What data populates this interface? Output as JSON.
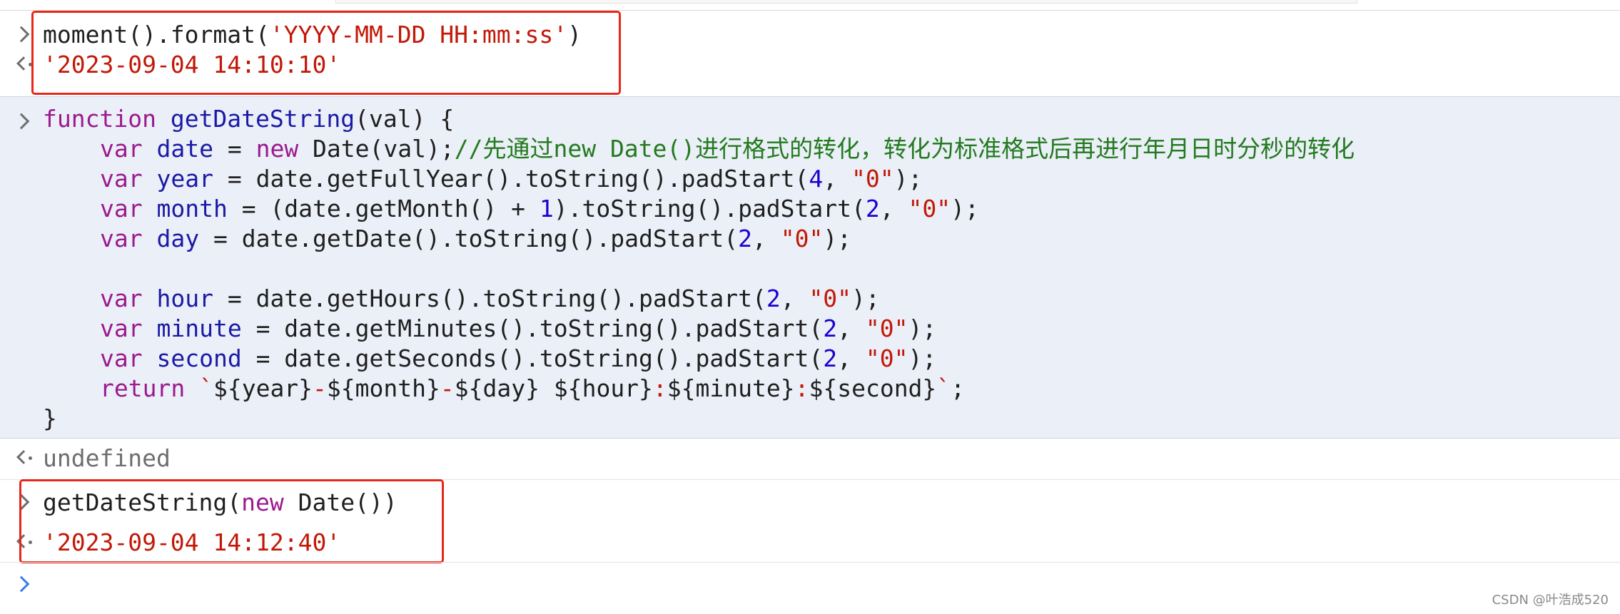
{
  "console": {
    "entry1": {
      "input": [
        "moment().format(",
        "'YYYY-MM-DD HH:mm:ss'",
        ")"
      ],
      "output": "'2023-09-04 14:10:10'"
    },
    "entry2": {
      "lines": {
        "l1": {
          "kw": "function",
          "fn": "getDateString",
          "rest": "(val) {"
        },
        "l2": {
          "kw": "var",
          "name": "date",
          "eq": " = ",
          "kw2": "new",
          "rest": " Date(val);",
          "cmt": "//先通过new Date()进行格式的转化，转化为标准格式后再进行年月日时分秒的转化"
        },
        "l3": {
          "kw": "var",
          "name": "year",
          "rest1": " = date.getFullYear().toString().padStart(",
          "num": "4",
          "rest2": ", ",
          "str": "\"0\"",
          "rest3": ");"
        },
        "l4": {
          "kw": "var",
          "name": "month",
          "rest1": " = (date.getMonth() + ",
          "num1": "1",
          "rest2": ").toString().padStart(",
          "num2": "2",
          "rest3": ", ",
          "str": "\"0\"",
          "rest4": ");"
        },
        "l5": {
          "kw": "var",
          "name": "day",
          "rest1": " = date.getDate().toString().padStart(",
          "num": "2",
          "rest2": ", ",
          "str": "\"0\"",
          "rest3": ");"
        },
        "l6": {
          "kw": "var",
          "name": "hour",
          "rest1": " = date.getHours().toString().padStart(",
          "num": "2",
          "rest2": ", ",
          "str": "\"0\"",
          "rest3": ");"
        },
        "l7": {
          "kw": "var",
          "name": "minute",
          "rest1": " = date.getMinutes().toString().padStart(",
          "num": "2",
          "rest2": ", ",
          "str": "\"0\"",
          "rest3": ");"
        },
        "l8": {
          "kw": "var",
          "name": "second",
          "rest1": " = date.getSeconds().toString().padStart(",
          "num": "2",
          "rest2": ", ",
          "str": "\"0\"",
          "rest3": ");"
        },
        "l9": {
          "kw": "return",
          "t1": " `",
          "p1": "${year}",
          "d1": "-",
          "p2": "${month}",
          "d2": "-",
          "p3": "${day}",
          "sp": " ",
          "p4": "${hour}",
          "c1": ":",
          "p5": "${minute}",
          "c2": ":",
          "p6": "${second}",
          "t2": "`",
          "end": ";"
        },
        "l10": {
          "rest": "}"
        }
      },
      "output": "undefined"
    },
    "entry3": {
      "input": [
        "getDateString(",
        "new",
        " Date())"
      ],
      "output": "'2023-09-04 14:12:40'"
    }
  },
  "watermark": "CSDN @叶浩成520",
  "colors": {
    "highlight_box": "#e8271a",
    "keyword": "#9b1a8f",
    "string": "#c21807",
    "number": "#1c00cf",
    "comment": "#237a1f",
    "function_name": "#1a1aa6",
    "prompt_active": "#3b7de0"
  }
}
